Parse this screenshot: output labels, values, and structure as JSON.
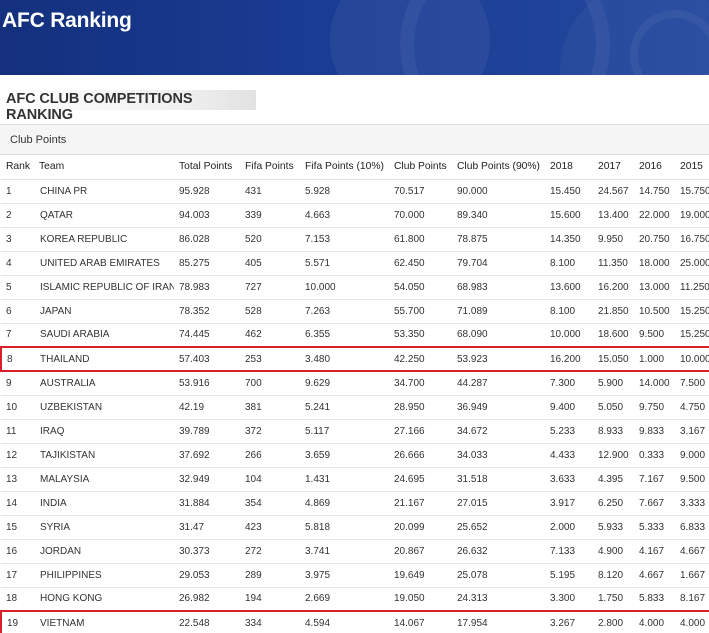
{
  "banner": {
    "title": "AFC Ranking"
  },
  "section": {
    "heading": "AFC CLUB COMPETITIONS RANKING"
  },
  "panel": {
    "label": "Club Points"
  },
  "table": {
    "headers": [
      "Rank",
      "Team",
      "Total Points",
      "Fifa Points",
      "Fifa Points (10%)",
      "Club Points",
      "Club Points (90%)",
      "2018",
      "2017",
      "2016",
      "2015"
    ],
    "rows": [
      [
        "1",
        "CHINA PR",
        "95.928",
        "431",
        "5.928",
        "70.517",
        "90.000",
        "15.450",
        "24.567",
        "14.750",
        "15.750"
      ],
      [
        "2",
        "QATAR",
        "94.003",
        "339",
        "4.663",
        "70.000",
        "89.340",
        "15.600",
        "13.400",
        "22.000",
        "19.000"
      ],
      [
        "3",
        "KOREA REPUBLIC",
        "86.028",
        "520",
        "7.153",
        "61.800",
        "78.875",
        "14.350",
        "9.950",
        "20.750",
        "16.750"
      ],
      [
        "4",
        "UNITED ARAB EMIRATES",
        "85.275",
        "405",
        "5.571",
        "62.450",
        "79.704",
        "8.100",
        "11.350",
        "18.000",
        "25.000"
      ],
      [
        "5",
        "ISLAMIC REPUBLIC OF IRAN",
        "78.983",
        "727",
        "10.000",
        "54.050",
        "68.983",
        "13.600",
        "16.200",
        "13.000",
        "11.250"
      ],
      [
        "6",
        "JAPAN",
        "78.352",
        "528",
        "7.263",
        "55.700",
        "71.089",
        "8.100",
        "21.850",
        "10.500",
        "15.250"
      ],
      [
        "7",
        "SAUDI ARABIA",
        "74.445",
        "462",
        "6.355",
        "53.350",
        "68.090",
        "10.000",
        "18.600",
        "9.500",
        "15.250"
      ],
      [
        "8",
        "THAILAND",
        "57.403",
        "253",
        "3.480",
        "42.250",
        "53.923",
        "16.200",
        "15.050",
        "1.000",
        "10.000"
      ],
      [
        "9",
        "AUSTRALIA",
        "53.916",
        "700",
        "9.629",
        "34.700",
        "44.287",
        "7.300",
        "5.900",
        "14.000",
        "7.500"
      ],
      [
        "10",
        "UZBEKISTAN",
        "42.19",
        "381",
        "5.241",
        "28.950",
        "36.949",
        "9.400",
        "5.050",
        "9.750",
        "4.750"
      ],
      [
        "11",
        "IRAQ",
        "39.789",
        "372",
        "5.117",
        "27.166",
        "34.672",
        "5.233",
        "8.933",
        "9.833",
        "3.167"
      ],
      [
        "12",
        "TAJIKISTAN",
        "37.692",
        "266",
        "3.659",
        "26.666",
        "34.033",
        "4.433",
        "12.900",
        "0.333",
        "9.000"
      ],
      [
        "13",
        "MALAYSIA",
        "32.949",
        "104",
        "1.431",
        "24.695",
        "31.518",
        "3.633",
        "4.395",
        "7.167",
        "9.500"
      ],
      [
        "14",
        "INDIA",
        "31.884",
        "354",
        "4.869",
        "21.167",
        "27.015",
        "3.917",
        "6.250",
        "7.667",
        "3.333"
      ],
      [
        "15",
        "SYRIA",
        "31.47",
        "423",
        "5.818",
        "20.099",
        "25.652",
        "2.000",
        "5.933",
        "5.333",
        "6.833"
      ],
      [
        "16",
        "JORDAN",
        "30.373",
        "272",
        "3.741",
        "20.867",
        "26.632",
        "7.133",
        "4.900",
        "4.167",
        "4.667"
      ],
      [
        "17",
        "PHILIPPINES",
        "29.053",
        "289",
        "3.975",
        "19.649",
        "25.078",
        "5.195",
        "8.120",
        "4.667",
        "1.667"
      ],
      [
        "18",
        "HONG KONG",
        "26.982",
        "194",
        "2.669",
        "19.050",
        "24.313",
        "3.300",
        "1.750",
        "5.833",
        "8.167"
      ],
      [
        "19",
        "VIETNAM",
        "22.548",
        "334",
        "4.594",
        "14.067",
        "17.954",
        "3.267",
        "2.800",
        "4.000",
        "4.000"
      ]
    ],
    "highlighted_ranks": [
      "8",
      "19"
    ],
    "highlight_color": "#d81f2a"
  },
  "colors": {
    "banner": "#1a3c93",
    "banner_text": "#ffffff"
  }
}
